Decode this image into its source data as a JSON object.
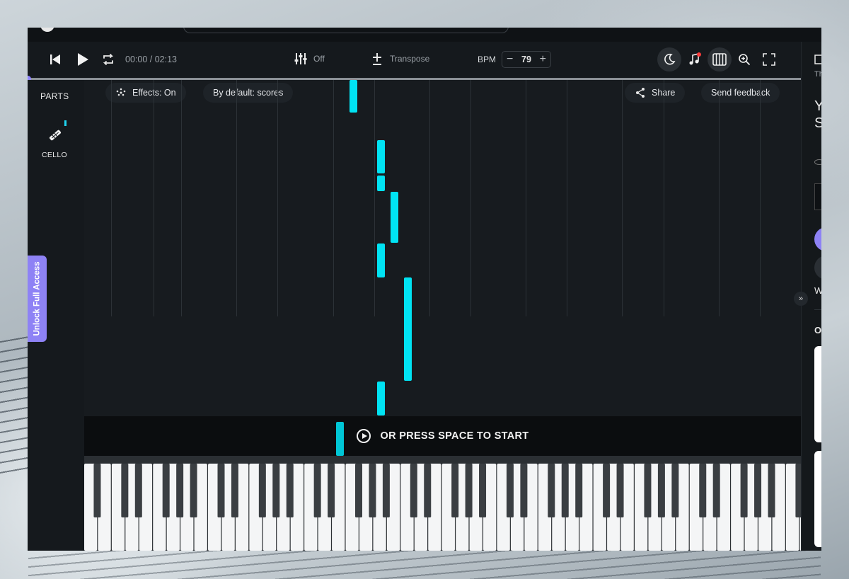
{
  "player": {
    "time": "00:00 / 02:13",
    "mixer_label": "Off",
    "transpose_label": "Transpose",
    "bpm_label": "BPM",
    "bpm_value": "79",
    "bpm_minus": "−",
    "bpm_plus": "+"
  },
  "progress": 0,
  "parts": {
    "title": "PARTS",
    "items": [
      {
        "label": "CELLO"
      }
    ]
  },
  "unlock_label": "Unlock Full Access",
  "roll": {
    "effects_label": "Effects: On",
    "mode_label": "By default: scores",
    "share_label": "Share",
    "feedback_label": "Send feedback"
  },
  "start_prompt": "OR PRESS SPACE TO START",
  "sidebar": {
    "t1": "Th",
    "t2": "Y",
    "t3": "S",
    "t4": "W",
    "t5": "O"
  },
  "colors": {
    "accent": "#8e82f5",
    "note": "#00e3f3",
    "background": "#15191d"
  },
  "icons": [
    "skip-back-icon",
    "play-icon",
    "loop-icon",
    "mixer-icon",
    "transpose-icon",
    "moon-icon",
    "music-note-icon",
    "piano-icon",
    "zoom-icon",
    "fullscreen-icon",
    "sparkle-icon",
    "share-icon",
    "cello-icon",
    "chevron-right-double-icon",
    "play-circle-icon"
  ]
}
